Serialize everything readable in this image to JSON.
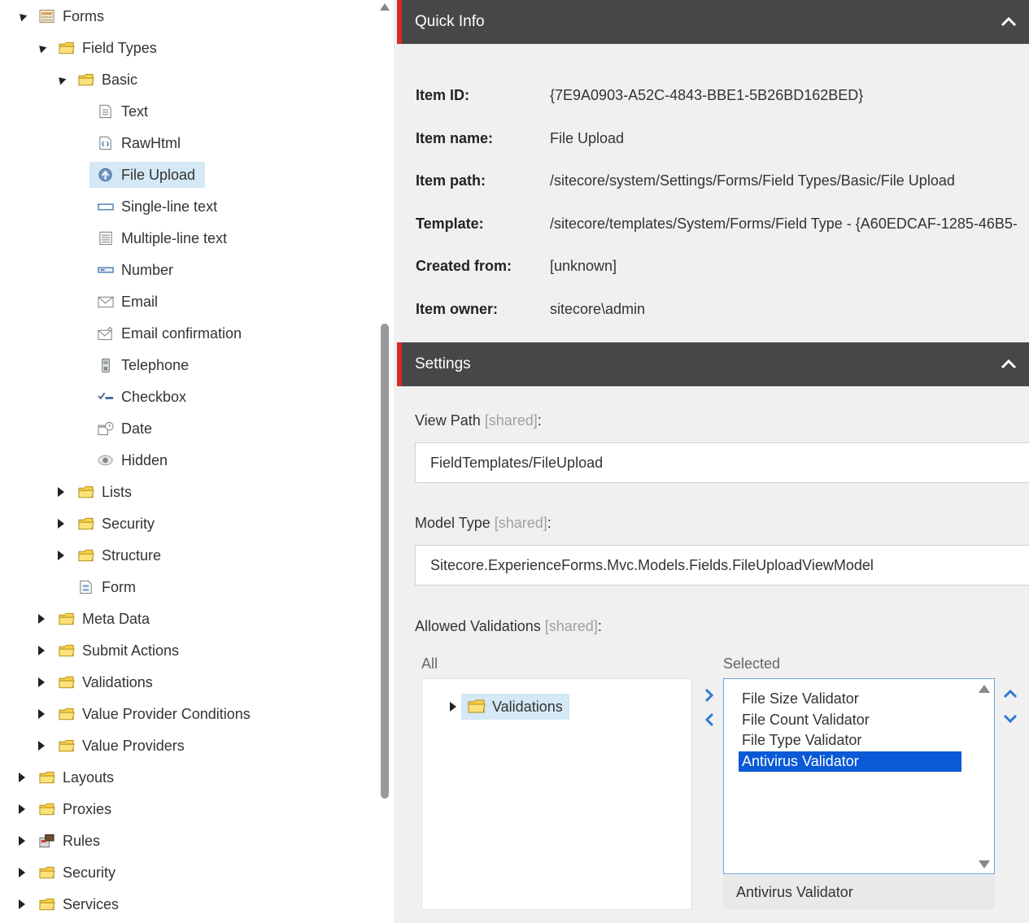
{
  "tree": {
    "nodes": [
      {
        "label": "Forms",
        "depth": 0,
        "expand": "down",
        "icon": "forms-icon"
      },
      {
        "label": "Field Types",
        "depth": 1,
        "expand": "down",
        "icon": "folder-icon"
      },
      {
        "label": "Basic",
        "depth": 2,
        "expand": "down",
        "icon": "folder-icon"
      },
      {
        "label": "Text",
        "depth": 3,
        "expand": "none",
        "icon": "document-icon"
      },
      {
        "label": "RawHtml",
        "depth": 3,
        "expand": "none",
        "icon": "code-document-icon"
      },
      {
        "label": "File Upload",
        "depth": 3,
        "expand": "none",
        "icon": "file-upload-icon",
        "selected": true
      },
      {
        "label": "Single-line text",
        "depth": 3,
        "expand": "none",
        "icon": "textbox-icon"
      },
      {
        "label": "Multiple-line text",
        "depth": 3,
        "expand": "none",
        "icon": "multiline-icon"
      },
      {
        "label": "Number",
        "depth": 3,
        "expand": "none",
        "icon": "number-icon"
      },
      {
        "label": "Email",
        "depth": 3,
        "expand": "none",
        "icon": "email-icon"
      },
      {
        "label": "Email confirmation",
        "depth": 3,
        "expand": "none",
        "icon": "email-confirm-icon"
      },
      {
        "label": "Telephone",
        "depth": 3,
        "expand": "none",
        "icon": "telephone-icon"
      },
      {
        "label": "Checkbox",
        "depth": 3,
        "expand": "none",
        "icon": "checkbox-icon"
      },
      {
        "label": "Date",
        "depth": 3,
        "expand": "none",
        "icon": "calendar-icon"
      },
      {
        "label": "Hidden",
        "depth": 3,
        "expand": "none",
        "icon": "eye-icon"
      },
      {
        "label": "Lists",
        "depth": 2,
        "expand": "right",
        "icon": "folder-icon"
      },
      {
        "label": "Security",
        "depth": 2,
        "expand": "right",
        "icon": "folder-icon"
      },
      {
        "label": "Structure",
        "depth": 2,
        "expand": "right",
        "icon": "folder-icon"
      },
      {
        "label": "Form",
        "depth": 2,
        "expand": "none",
        "icon": "form-document-icon"
      },
      {
        "label": "Meta Data",
        "depth": 1,
        "expand": "right",
        "icon": "folder-icon"
      },
      {
        "label": "Submit Actions",
        "depth": 1,
        "expand": "right",
        "icon": "folder-icon"
      },
      {
        "label": "Validations",
        "depth": 1,
        "expand": "right",
        "icon": "folder-icon"
      },
      {
        "label": "Value Provider Conditions",
        "depth": 1,
        "expand": "right",
        "icon": "folder-icon"
      },
      {
        "label": "Value Providers",
        "depth": 1,
        "expand": "right",
        "icon": "folder-icon"
      },
      {
        "label": "Layouts",
        "depth": 0,
        "expand": "right",
        "icon": "folder-icon"
      },
      {
        "label": "Proxies",
        "depth": 0,
        "expand": "right",
        "icon": "folder-icon"
      },
      {
        "label": "Rules",
        "depth": 0,
        "expand": "right",
        "icon": "rules-icon"
      },
      {
        "label": "Security",
        "depth": 0,
        "expand": "right",
        "icon": "folder-icon"
      },
      {
        "label": "Services",
        "depth": 0,
        "expand": "right",
        "icon": "folder-icon"
      }
    ]
  },
  "quick_info": {
    "title": "Quick Info",
    "rows": [
      {
        "label": "Item ID:",
        "value": "{7E9A0903-A52C-4843-BBE1-5B26BD162BED}"
      },
      {
        "label": "Item name:",
        "value": "File Upload"
      },
      {
        "label": "Item path:",
        "value": "/sitecore/system/Settings/Forms/Field Types/Basic/File Upload"
      },
      {
        "label": "Template:",
        "value": "/sitecore/templates/System/Forms/Field Type - {A60EDCAF-1285-46B5-"
      },
      {
        "label": "Created from:",
        "value": "[unknown]"
      },
      {
        "label": "Item owner:",
        "value": "sitecore\\admin"
      }
    ]
  },
  "settings": {
    "title": "Settings",
    "view_path": {
      "label": "View Path",
      "shared": "[shared]",
      "colon": ":",
      "value": "FieldTemplates/FileUpload"
    },
    "model_type": {
      "label": "Model Type",
      "shared": "[shared]",
      "colon": ":",
      "value": "Sitecore.ExperienceForms.Mvc.Models.Fields.FileUploadViewModel"
    },
    "allowed_validations": {
      "label": "Allowed Validations",
      "shared": "[shared]",
      "colon": ":",
      "all_label": "All",
      "selected_label": "Selected",
      "all_tree_item": "Validations",
      "selected_items": [
        "File Size Validator",
        "File Count Validator",
        "File Type Validator",
        "Antivirus Validator"
      ],
      "selected_index": 3,
      "selected_description": "Antivirus Validator"
    }
  },
  "colors": {
    "header_bg": "#474747",
    "header_accent": "#d42b2b",
    "selection_blue": "#0a59d6",
    "tree_highlight": "#d4e8f5",
    "arrow_blue": "#2f7bd1"
  }
}
